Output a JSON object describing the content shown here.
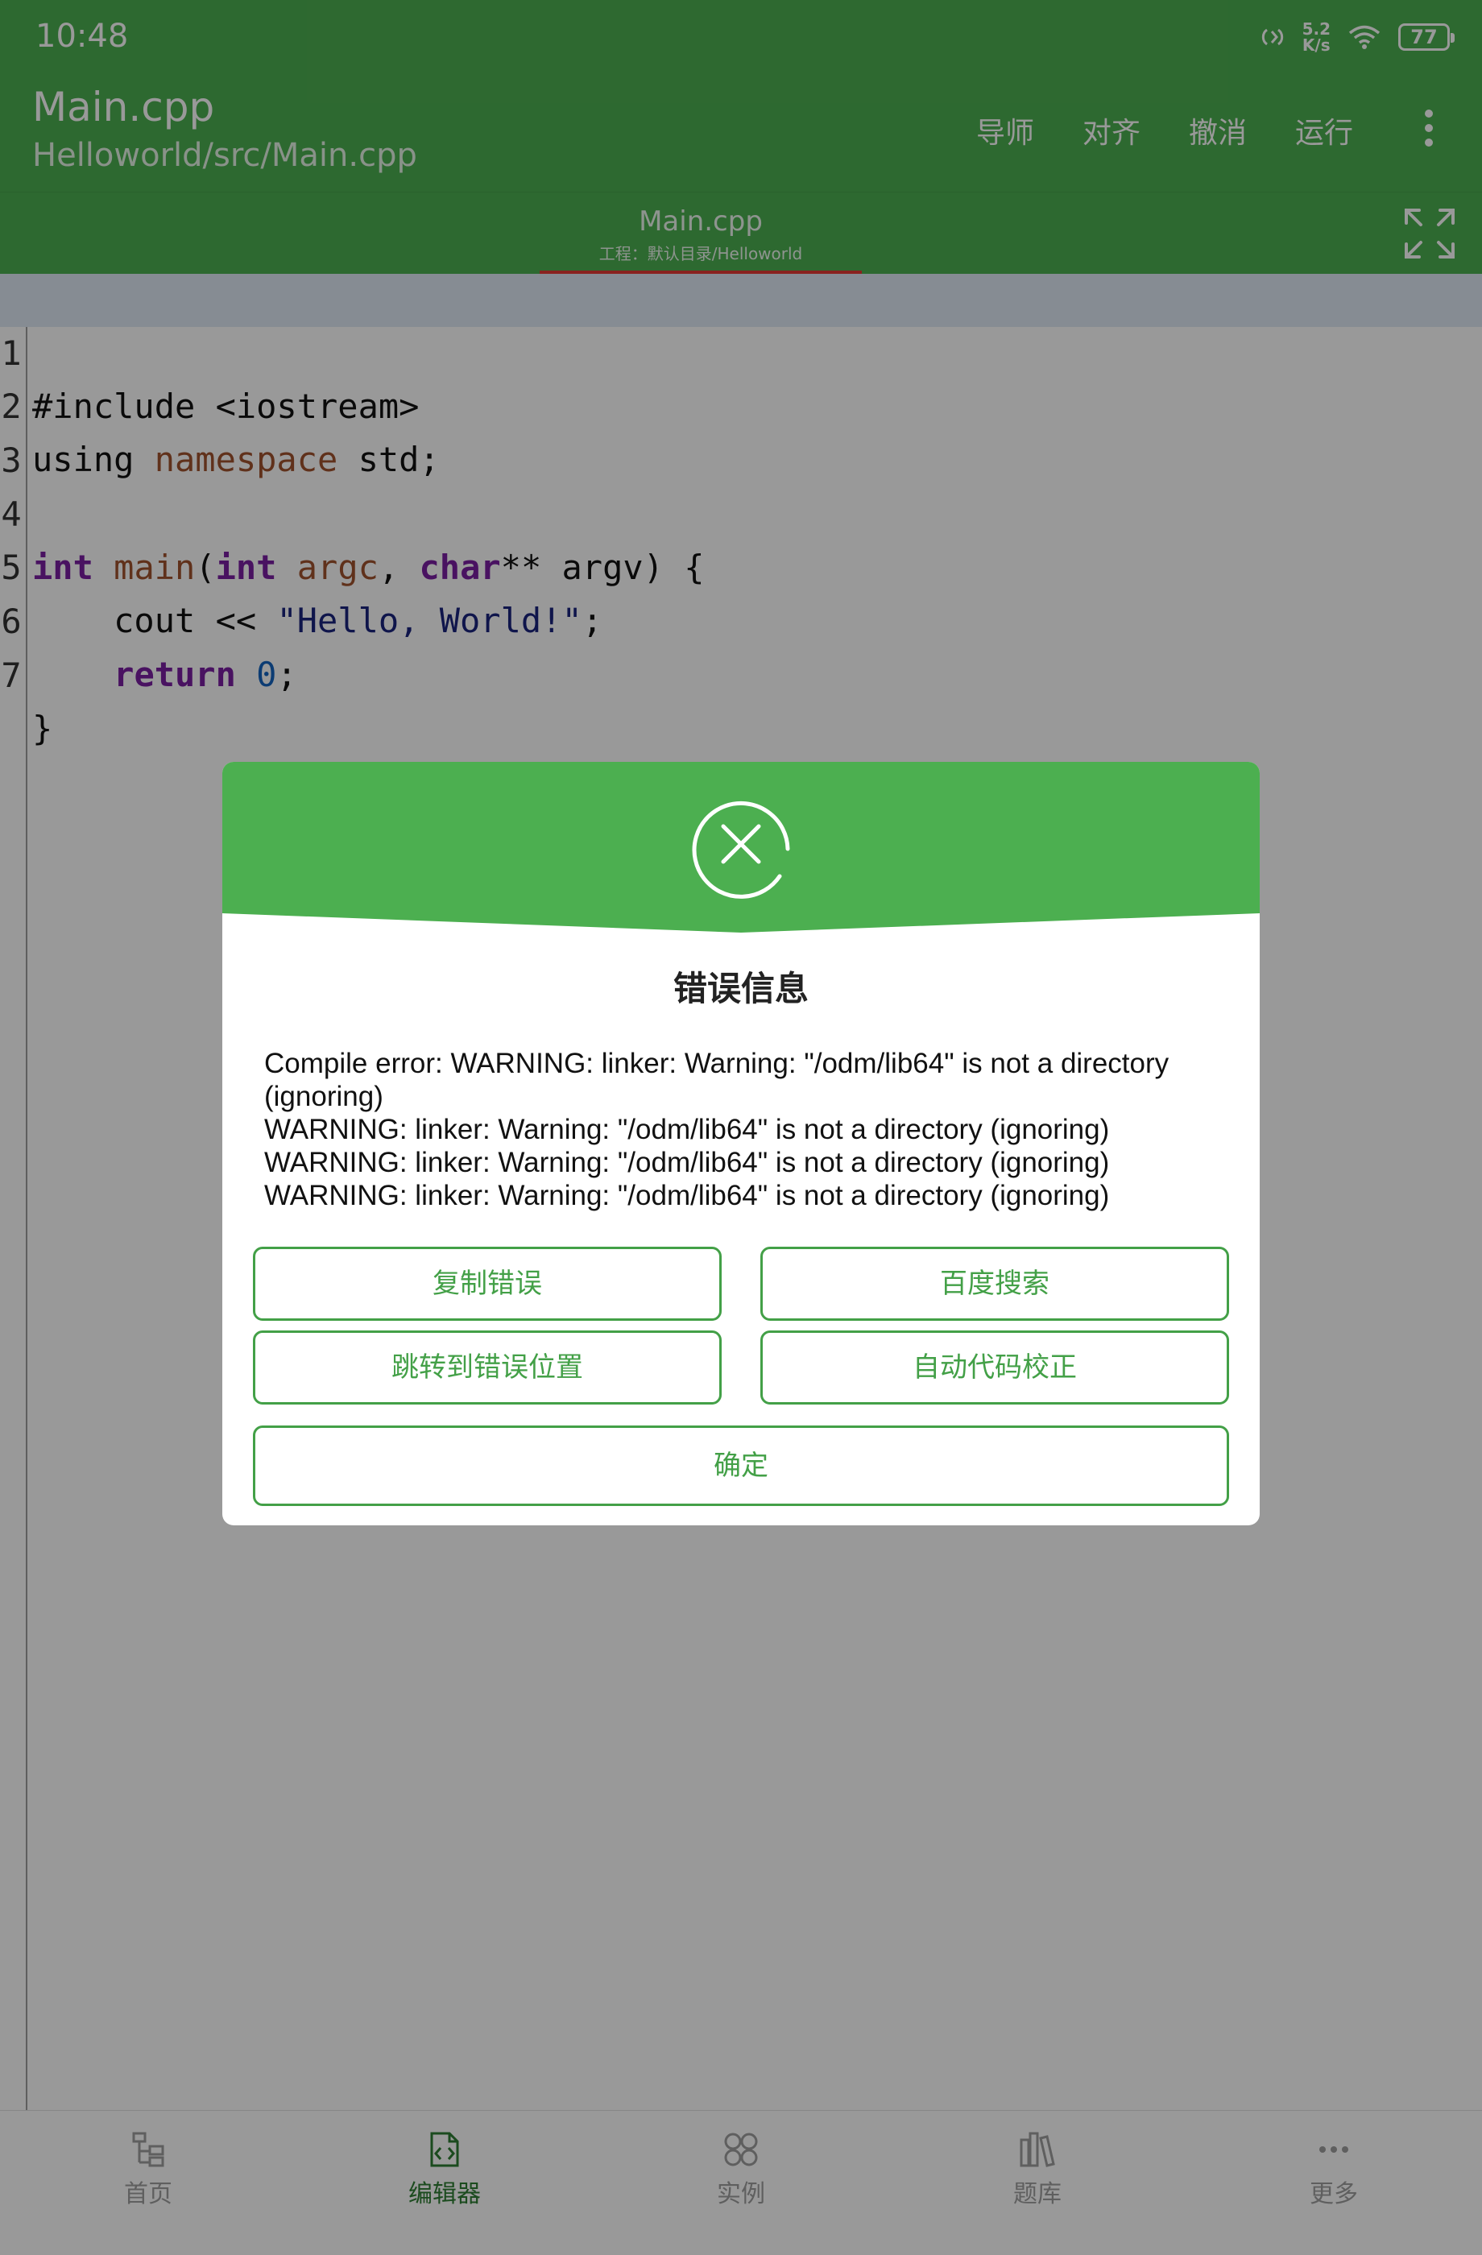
{
  "status_bar": {
    "time": "10:48",
    "net_speed_value": "5.2",
    "net_speed_unit": "K/s",
    "battery": "77"
  },
  "app_bar": {
    "title": "Main.cpp",
    "subtitle": "Helloworld/src/Main.cpp",
    "actions": [
      "导师",
      "对齐",
      "撤消",
      "运行"
    ]
  },
  "tab": {
    "name": "Main.cpp",
    "project": "工程：默认目录/Helloworld"
  },
  "editor": {
    "line_numbers": [
      "1",
      "2",
      "3",
      "4",
      "5",
      "6",
      "7"
    ],
    "lines": [
      "#include <iostream>",
      "using namespace std;",
      "",
      "int main(int argc, char** argv) {",
      "    cout << \"Hello, World!\";",
      "    return 0;",
      "}"
    ]
  },
  "dialog": {
    "title": "错误信息",
    "message_lines": [
      "Compile error: WARNING: linker: Warning: \"/odm/lib64\" is not a directory",
      "(ignoring)",
      "WARNING: linker: Warning: \"/odm/lib64\" is not a directory (ignoring)",
      "WARNING: linker: Warning: \"/odm/lib64\" is not a directory (ignoring)",
      "WARNING: linker: Warning: \"/odm/lib64\" is not a directory (ignoring)"
    ],
    "buttons": {
      "copy_error": "复制错误",
      "baidu_search": "百度搜索",
      "jump_to_error": "跳转到错误位置",
      "auto_correct": "自动代码校正",
      "ok": "确定"
    }
  },
  "bottom_nav": {
    "items": [
      "首页",
      "编辑器",
      "实例",
      "题库",
      "更多"
    ],
    "active": "编辑器"
  },
  "colors": {
    "primary": "#4caf50",
    "accent_indicator": "#e53935",
    "button_outline": "#43a047"
  }
}
